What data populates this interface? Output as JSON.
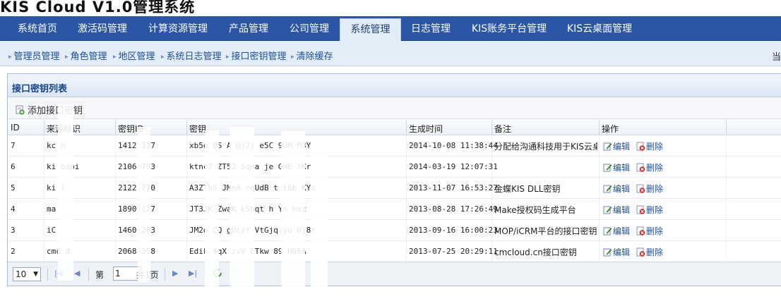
{
  "app": {
    "title": "KIS Cloud V1.0管理系统"
  },
  "main_nav": {
    "tabs": [
      {
        "label": "系统首页"
      },
      {
        "label": "激活码管理"
      },
      {
        "label": "计算资源管理"
      },
      {
        "label": "产品管理"
      },
      {
        "label": "公司管理"
      },
      {
        "label": "系统管理",
        "active": true
      },
      {
        "label": "日志管理"
      },
      {
        "label": "KIS账务平台管理"
      },
      {
        "label": "KIS云桌面管理"
      }
    ]
  },
  "sub_nav": {
    "items": [
      {
        "label": "管理员管理"
      },
      {
        "label": "角色管理"
      },
      {
        "label": "地区管理"
      },
      {
        "label": "系统日志管理"
      },
      {
        "label": "接口密钥管理"
      },
      {
        "label": "清除缓存"
      }
    ],
    "right_text": "当"
  },
  "panel": {
    "title": "接口密钥列表",
    "add_button": "添加接口密钥"
  },
  "table": {
    "headers": [
      "ID",
      "来源标识",
      "密钥ID",
      "密钥",
      "生成时间",
      "备注",
      "操作"
    ],
    "rows": [
      {
        "id": "7",
        "source": "kc  n",
        "key_id": "1412   337",
        "key": "xb5e  bS   A   Bj2j   e5C   9DM   M3Y",
        "time": "2014-10-08 11:38:44",
        "note": "分配给沟通科技用于KIS云桌",
        "edit": "编辑",
        "delete": "删除"
      },
      {
        "id": "6",
        "source": "ki  bapi",
        "key_id": "2106   793",
        "key": "ktnc7   ZT52   Sqna   je   GHE   YKr",
        "time": "2014-03-19 12:07:31",
        "note": "",
        "edit": "编辑",
        "delete": "删除"
      },
      {
        "id": "5",
        "source": "ki  l",
        "key_id": "2122   770",
        "key": "A3ZTh5   JMnA   rqUdB   t   t6b   KYs",
        "time": "2013-11-07 16:53:27",
        "note": "金蝶KIS DLL密钥",
        "edit": "编辑",
        "delete": "删除"
      },
      {
        "id": "4",
        "source": "ma",
        "key_id": "1890   177",
        "key": "JT3JK   ZwaK   kSbqt   h   Yn   hxz",
        "time": "2013-08-28 17:26:49",
        "note": "Make授权码生成平台",
        "edit": "编辑",
        "delete": "删除"
      },
      {
        "id": "3",
        "source": "iC",
        "key_id": "1460   203",
        "key": "JM2e   CQ   gUczY   VtGjq   yu   Uj8r",
        "time": "2013-09-16 16:00:23",
        "note": "MOP/iCRM平台的接口密钥...",
        "edit": "编辑",
        "delete": "删除"
      },
      {
        "id": "2",
        "source": "cmc  d",
        "key_id": "2068   358",
        "key": "Edik   tqX   zvV   ETkw   89   H65A",
        "time": "2013-07-25 20:29:11",
        "note": "cmcloud.cn接口密钥",
        "edit": "编辑",
        "delete": "删除"
      }
    ]
  },
  "pager": {
    "page_size": "10",
    "page_prefix": "第",
    "page_value": "1",
    "page_total": "共1页"
  },
  "colors": {
    "nav_bg": "#2b56a6",
    "subnav_bg": "#e3edf8",
    "link": "#1d4f9a",
    "panel_title": "#15428b"
  }
}
